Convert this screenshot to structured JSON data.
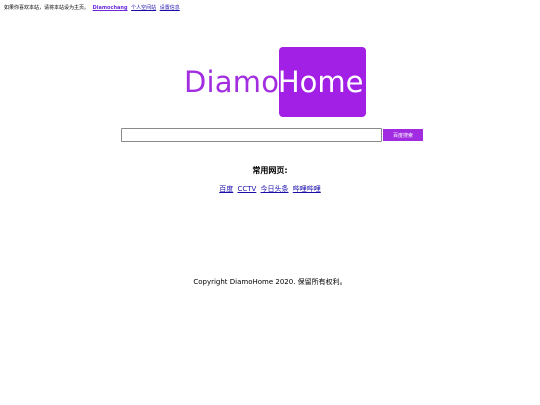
{
  "topbar": {
    "notice": "如果你喜欢本站，请将本站设为主页。",
    "brand_link": "Diamochang",
    "site_link": "个人空间站",
    "settings_link": "设置信息"
  },
  "logo": {
    "part1": "Diamo",
    "part2": "Home"
  },
  "search": {
    "value": "",
    "placeholder": "",
    "button_label": "百度搜索"
  },
  "common": {
    "title": "常用网页:",
    "links": [
      "百度",
      "CCTV",
      "今日头条",
      "哔哩哔哩"
    ]
  },
  "footer": {
    "copyright": "Copyright DiamoHome 2020. 保留所有权利。"
  },
  "colors": {
    "brand_purple": "#a21fe6",
    "link_blue": "#1a0dab"
  }
}
